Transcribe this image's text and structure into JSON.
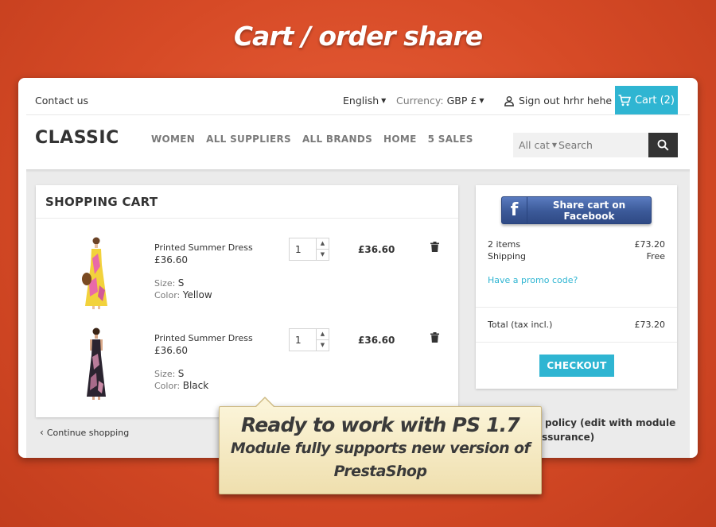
{
  "banner": {
    "title": "Cart / order share"
  },
  "topnav": {
    "contact": "Contact us",
    "language": "English",
    "currency_label": "Currency:",
    "currency_value": "GBP £",
    "signout": "Sign out",
    "username": "hrhr hehe",
    "cart": "Cart (2)"
  },
  "header": {
    "brand": "CLASSIC",
    "menu": [
      "WOMEN",
      "ALL SUPPLIERS",
      "ALL BRANDS",
      "HOME",
      "5 SALES"
    ],
    "search_category": "All cat",
    "search_placeholder": "Search"
  },
  "cart": {
    "title": "SHOPPING CART",
    "items": [
      {
        "name": "Printed Summer Dress",
        "price": "£36.60",
        "size_label": "Size:",
        "size": "S",
        "color_label": "Color:",
        "color": "Yellow",
        "quantity": "1",
        "total": "£36.60"
      },
      {
        "name": "Printed Summer Dress",
        "price": "£36.60",
        "size_label": "Size:",
        "size": "S",
        "color_label": "Color:",
        "color": "Black",
        "quantity": "1",
        "total": "£36.60"
      }
    ],
    "continue": "Continue shopping"
  },
  "summary": {
    "facebook_button": "Share cart on Facebook",
    "items_label": "2 items",
    "items_value": "£73.20",
    "shipping_label": "Shipping",
    "shipping_value": "Free",
    "promo": "Have a promo code?",
    "total_label": "Total (tax incl.)",
    "total_value": "£73.20",
    "checkout": "CHECKOUT"
  },
  "reassurance": {
    "line1": "y policy (edit with module",
    "line2": "assurance)"
  },
  "callout": {
    "heading": "Ready to work with PS 1.7",
    "line1": "Module fully supports new version of",
    "line2": "PrestaShop"
  },
  "colors": {
    "accent": "#2fb5d2",
    "background": "#d64a26",
    "facebook": "#3b5998"
  }
}
